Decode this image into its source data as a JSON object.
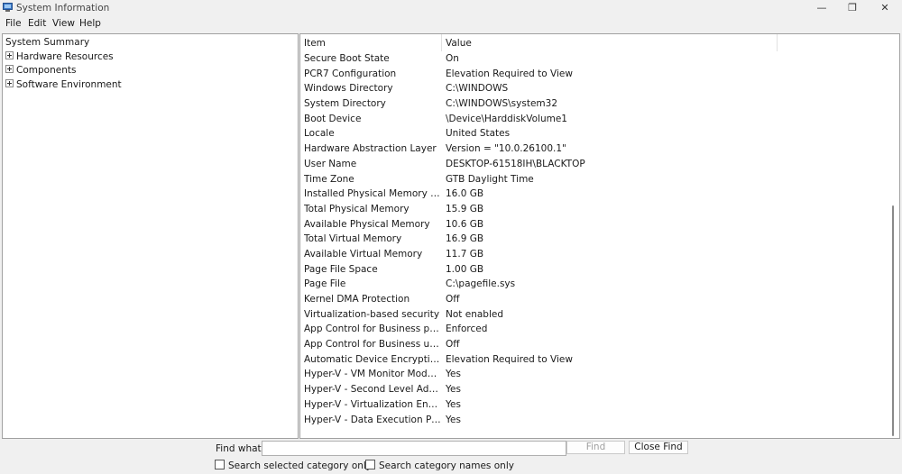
{
  "window": {
    "title": "System Information",
    "controls": {
      "minimize": "—",
      "restore": "❐",
      "close": "✕"
    }
  },
  "menu": [
    "File",
    "Edit",
    "View",
    "Help"
  ],
  "tree": [
    {
      "label": "System Summary",
      "expandable": false
    },
    {
      "label": "Hardware Resources",
      "expandable": true
    },
    {
      "label": "Components",
      "expandable": true
    },
    {
      "label": "Software Environment",
      "expandable": true
    }
  ],
  "list": {
    "columns": [
      "Item",
      "Value"
    ],
    "rows": [
      {
        "item": "Secure Boot State",
        "value": "On"
      },
      {
        "item": "PCR7 Configuration",
        "value": "Elevation Required to View"
      },
      {
        "item": "Windows Directory",
        "value": "C:\\WINDOWS"
      },
      {
        "item": "System Directory",
        "value": "C:\\WINDOWS\\system32"
      },
      {
        "item": "Boot Device",
        "value": "\\Device\\HarddiskVolume1"
      },
      {
        "item": "Locale",
        "value": "United States"
      },
      {
        "item": "Hardware Abstraction Layer",
        "value": "Version = \"10.0.26100.1\""
      },
      {
        "item": "User Name",
        "value": "DESKTOP-61518IH\\BLACKTOP"
      },
      {
        "item": "Time Zone",
        "value": "GTB Daylight Time"
      },
      {
        "item": "Installed Physical Memory (RAM)",
        "value": "16.0 GB"
      },
      {
        "item": "Total Physical Memory",
        "value": "15.9 GB"
      },
      {
        "item": "Available Physical Memory",
        "value": "10.6 GB"
      },
      {
        "item": "Total Virtual Memory",
        "value": "16.9 GB"
      },
      {
        "item": "Available Virtual Memory",
        "value": "11.7 GB"
      },
      {
        "item": "Page File Space",
        "value": "1.00 GB"
      },
      {
        "item": "Page File",
        "value": "C:\\pagefile.sys"
      },
      {
        "item": "Kernel DMA Protection",
        "value": "Off"
      },
      {
        "item": "Virtualization-based security",
        "value": "Not enabled"
      },
      {
        "item": "App Control for Business policy",
        "value": "Enforced"
      },
      {
        "item": "App Control for Business user m...",
        "value": "Off"
      },
      {
        "item": "Automatic Device Encryption Su...",
        "value": "Elevation Required to View"
      },
      {
        "item": "Hyper-V - VM Monitor Mode Ex...",
        "value": "Yes"
      },
      {
        "item": "Hyper-V - Second Level Address...",
        "value": "Yes"
      },
      {
        "item": "Hyper-V - Virtualization Enable...",
        "value": "Yes"
      },
      {
        "item": "Hyper-V - Data Execution Prote...",
        "value": "Yes"
      }
    ]
  },
  "find": {
    "label": "Find what:",
    "value": "",
    "find_button": "Find",
    "close_button": "Close Find",
    "search_selected_label": "Search selected category only",
    "search_names_label": "Search category names only"
  }
}
